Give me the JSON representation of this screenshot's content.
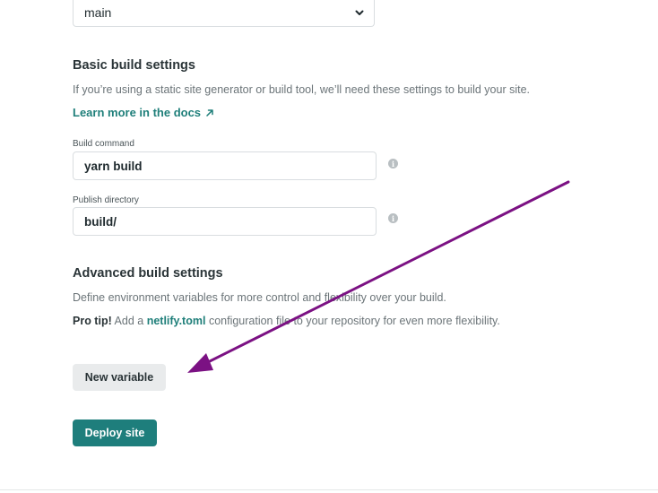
{
  "branch": {
    "selected": "main"
  },
  "basic": {
    "title": "Basic build settings",
    "description": "If you’re using a static site generator or build tool, we’ll need these settings to build your site.",
    "docs_link": "Learn more in the docs",
    "docs_link_icon": "arrow-up-right-icon"
  },
  "build_command": {
    "label": "Build command",
    "value": "yarn build"
  },
  "publish_directory": {
    "label": "Publish directory",
    "value": "build/"
  },
  "advanced": {
    "title": "Advanced build settings",
    "description": "Define environment variables for more control and flexibility over your build.",
    "protip_prefix": "Pro tip!",
    "protip_before": "Add a",
    "protip_file": "netlify.toml",
    "protip_after": "configuration file to your repository for even more flexibility."
  },
  "buttons": {
    "new_variable": "New variable",
    "deploy": "Deploy site"
  },
  "colors": {
    "accent": "#1e7e7c",
    "annotation_arrow": "#7b1183"
  }
}
